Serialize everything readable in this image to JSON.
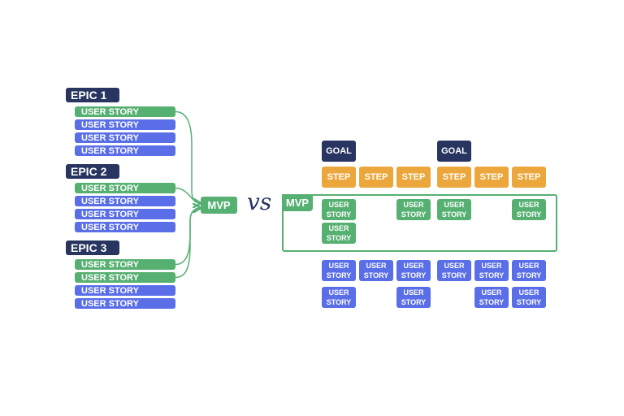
{
  "colors": {
    "navy": "#283560",
    "green": "#56b072",
    "blue": "#5a6ee8",
    "orange": "#eca73c"
  },
  "left": {
    "epics": [
      {
        "label": "EPIC 1",
        "stories": [
          {
            "label": "USER STORY",
            "mvp": true
          },
          {
            "label": "USER STORY",
            "mvp": false
          },
          {
            "label": "USER STORY",
            "mvp": false
          },
          {
            "label": "USER STORY",
            "mvp": false
          }
        ]
      },
      {
        "label": "EPIC 2",
        "stories": [
          {
            "label": "USER STORY",
            "mvp": true
          },
          {
            "label": "USER STORY",
            "mvp": false
          },
          {
            "label": "USER STORY",
            "mvp": false
          },
          {
            "label": "USER STORY",
            "mvp": false
          }
        ]
      },
      {
        "label": "EPIC 3",
        "stories": [
          {
            "label": "USER STORY",
            "mvp": true
          },
          {
            "label": "USER STORY",
            "mvp": true
          },
          {
            "label": "USER STORY",
            "mvp": false
          },
          {
            "label": "USER STORY",
            "mvp": false
          }
        ]
      }
    ],
    "mvp_label": "MVP"
  },
  "vs_label": "vs",
  "right": {
    "mvp_label": "MVP",
    "columns": [
      {
        "goal": "GOAL",
        "step": "STEP",
        "mvp_stories": [
          "USER STORY",
          "USER STORY"
        ],
        "other_stories": [
          "USER STORY",
          "USER STORY"
        ]
      },
      {
        "goal": null,
        "step": "STEP",
        "mvp_stories": [],
        "other_stories": [
          "USER STORY"
        ]
      },
      {
        "goal": null,
        "step": "STEP",
        "mvp_stories": [
          "USER STORY"
        ],
        "other_stories": [
          "USER STORY",
          "USER STORY"
        ]
      },
      {
        "goal": "GOAL",
        "step": "STEP",
        "mvp_stories": [
          "USER STORY"
        ],
        "other_stories": [
          "USER STORY"
        ]
      },
      {
        "goal": null,
        "step": "STEP",
        "mvp_stories": [],
        "other_stories": [
          "USER STORY",
          "USER STORY"
        ]
      },
      {
        "goal": null,
        "step": "STEP",
        "mvp_stories": [
          "USER STORY"
        ],
        "other_stories": [
          "USER STORY",
          "USER STORY"
        ]
      }
    ]
  }
}
